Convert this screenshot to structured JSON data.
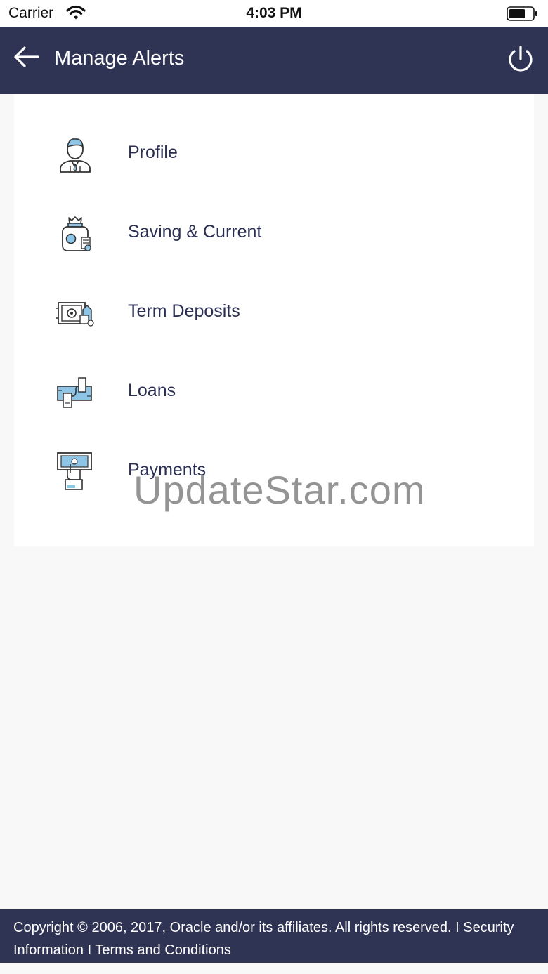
{
  "status_bar": {
    "carrier": "Carrier",
    "time": "4:03 PM",
    "wifi_icon": "wifi-icon",
    "battery_icon": "battery-icon",
    "battery_level": 0.6
  },
  "header": {
    "title": "Manage Alerts",
    "back_icon": "arrow-left-icon",
    "power_icon": "power-icon",
    "background": "#2f3354"
  },
  "menu": {
    "items": [
      {
        "label": "Profile",
        "icon": "profile-icon"
      },
      {
        "label": "Saving & Current",
        "icon": "saving-jar-icon"
      },
      {
        "label": "Term Deposits",
        "icon": "safe-deposit-icon"
      },
      {
        "label": "Loans",
        "icon": "loan-exchange-icon"
      },
      {
        "label": "Payments",
        "icon": "payment-hand-icon"
      }
    ]
  },
  "watermark": "UpdateStar.com",
  "footer": {
    "copyright": "Copyright © 2006, 2017, Oracle and/or its affiliates. All rights reserved.",
    "separator_1": "I",
    "security_link": "Security Information",
    "separator_2": "I",
    "terms_link": "Terms and Conditions"
  },
  "colors": {
    "primary": "#2f3354",
    "icon_accent": "#8ec5e6",
    "text": "#2b2f52"
  }
}
